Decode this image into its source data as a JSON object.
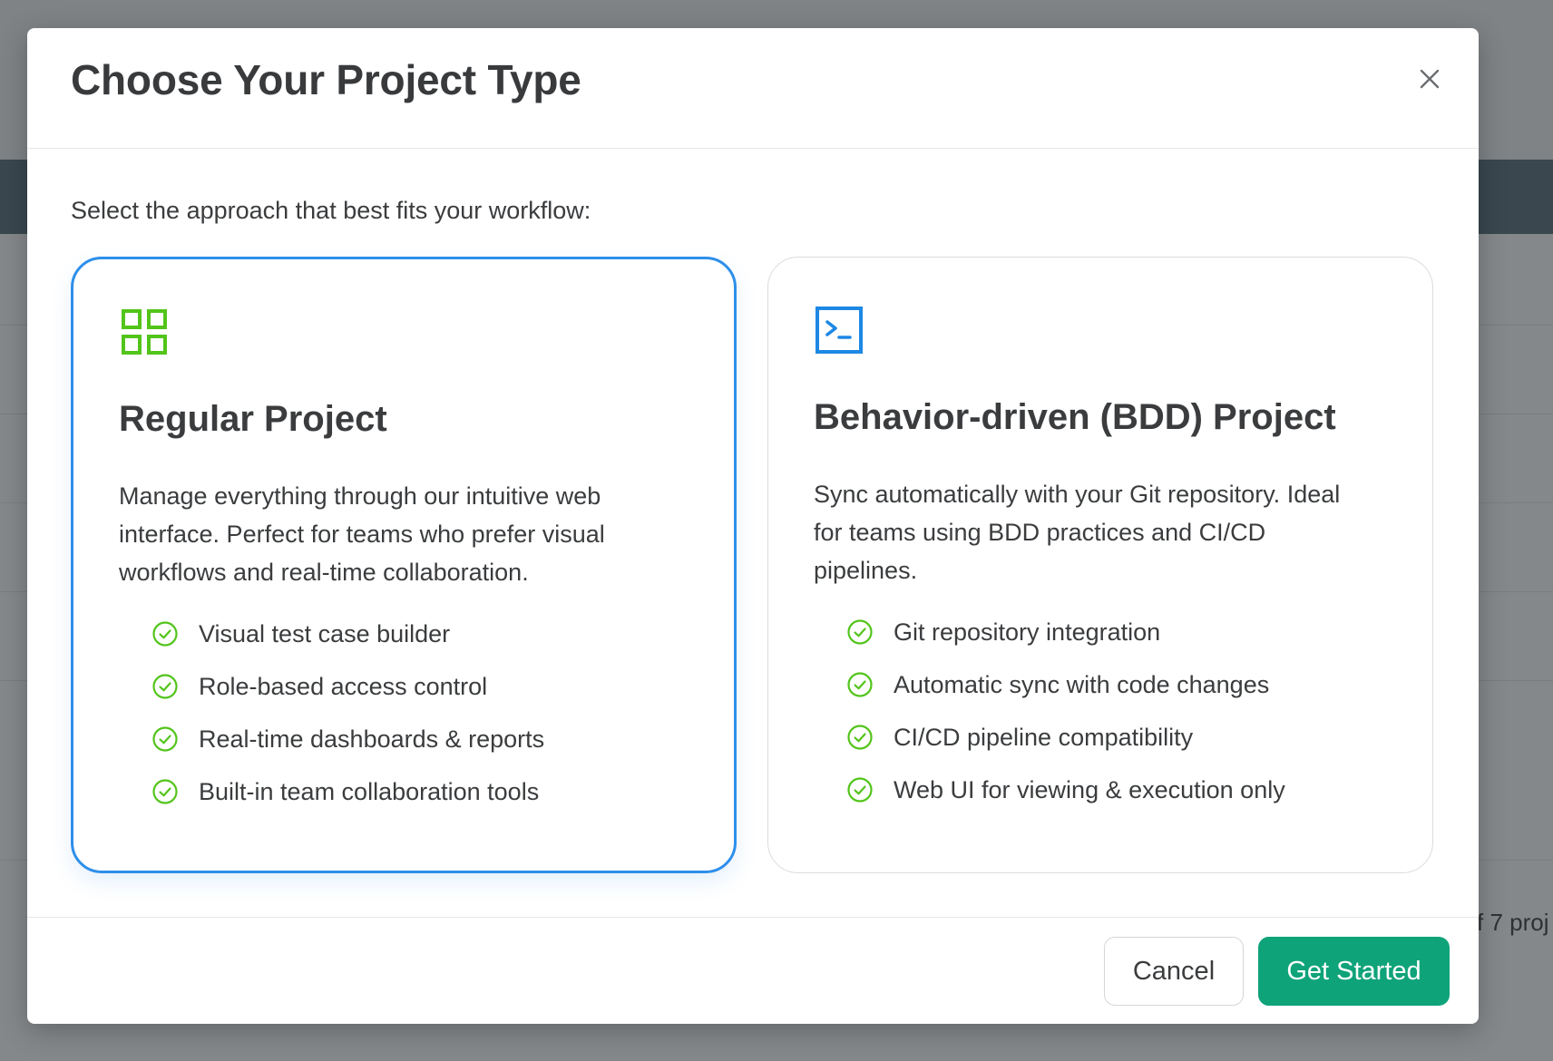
{
  "background": {
    "footer_text": "f 7 proj"
  },
  "modal": {
    "title": "Choose Your Project Type",
    "close_icon": "close-icon",
    "subtitle": "Select the approach that best fits your workflow:",
    "cards": [
      {
        "icon": "grid-icon",
        "icon_color": "#52c41a",
        "title": "Regular Project",
        "description": "Manage everything through our intuitive web interface. Perfect for teams who prefer visual workflows and real-time collaboration.",
        "selected": true,
        "features": [
          "Visual test case builder",
          "Role-based access control",
          "Real-time dashboards & reports",
          "Built-in team collaboration tools"
        ]
      },
      {
        "icon": "terminal-icon",
        "icon_color": "#1e88e5",
        "title": "Behavior-driven (BDD) Project",
        "description": "Sync automatically with your Git repository. Ideal for teams using BDD practices and CI/CD pipelines.",
        "selected": false,
        "features": [
          "Git repository integration",
          "Automatic sync with code changes",
          "CI/CD pipeline compatibility",
          "Web UI for viewing & execution only"
        ]
      }
    ],
    "footer": {
      "cancel_label": "Cancel",
      "primary_label": "Get Started"
    }
  },
  "colors": {
    "selected_border": "#2e8fea",
    "check": "#52c41a",
    "primary_button": "#0fa37a"
  }
}
